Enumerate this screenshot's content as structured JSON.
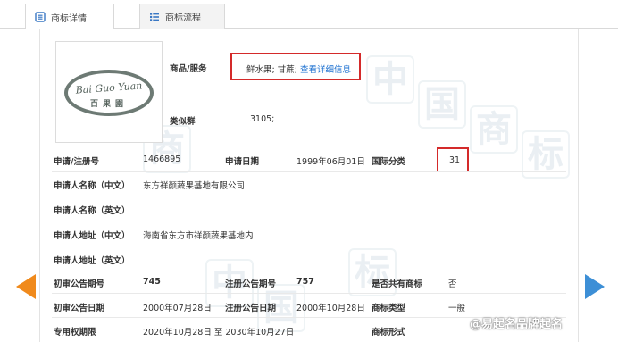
{
  "tabs": [
    {
      "label": "商标详情",
      "active": true,
      "icon": "document-list-icon"
    },
    {
      "label": "商标流程",
      "active": false,
      "icon": "process-list-icon"
    }
  ],
  "logo": {
    "text_en": "Bai Guo Yuan",
    "text_cn": "百果園"
  },
  "goods": {
    "label": "商品/服务",
    "value": "鲜水果; 甘蔗;",
    "link": "查看详细信息"
  },
  "similar_group": {
    "label": "类似群",
    "value": "3105;"
  },
  "rows": {
    "reg_no_label": "申请/注册号",
    "reg_no": "1466895",
    "app_date_label": "申请日期",
    "app_date": "1999年06月01日",
    "intl_class_label": "国际分类",
    "intl_class": "31",
    "applicant_cn_label": "申请人名称（中文）",
    "applicant_cn": "东方祥颜蔬果基地有限公司",
    "applicant_en_label": "申请人名称（英文）",
    "address_cn_label": "申请人地址（中文）",
    "address_cn": "海南省东方市祥颜蔬果基地内",
    "address_en_label": "申请人地址（英文）",
    "prelim_no_label": "初审公告期号",
    "prelim_no": "745",
    "reg_pub_no_label": "注册公告期号",
    "reg_pub_no": "757",
    "shared_label": "是否共有商标",
    "shared": "否",
    "prelim_date_label": "初审公告日期",
    "prelim_date": "2000年07月28日",
    "reg_pub_date_label": "注册公告日期",
    "reg_pub_date": "2000年10月28日",
    "tm_type_label": "商标类型",
    "tm_type": "一般",
    "exclusive_label": "专用权期限",
    "exclusive": "2020年10月28日 至 2030年10月27日",
    "tm_form_label": "商标形式"
  },
  "watermark": [
    "中",
    "国",
    "商",
    "标"
  ],
  "weibo_credit": "@易起名品牌起名",
  "colors": {
    "highlight_border": "#d42a2a",
    "link": "#1a6fd0",
    "arrow_left": "#f08a1c",
    "arrow_right": "#3d8fd6"
  }
}
